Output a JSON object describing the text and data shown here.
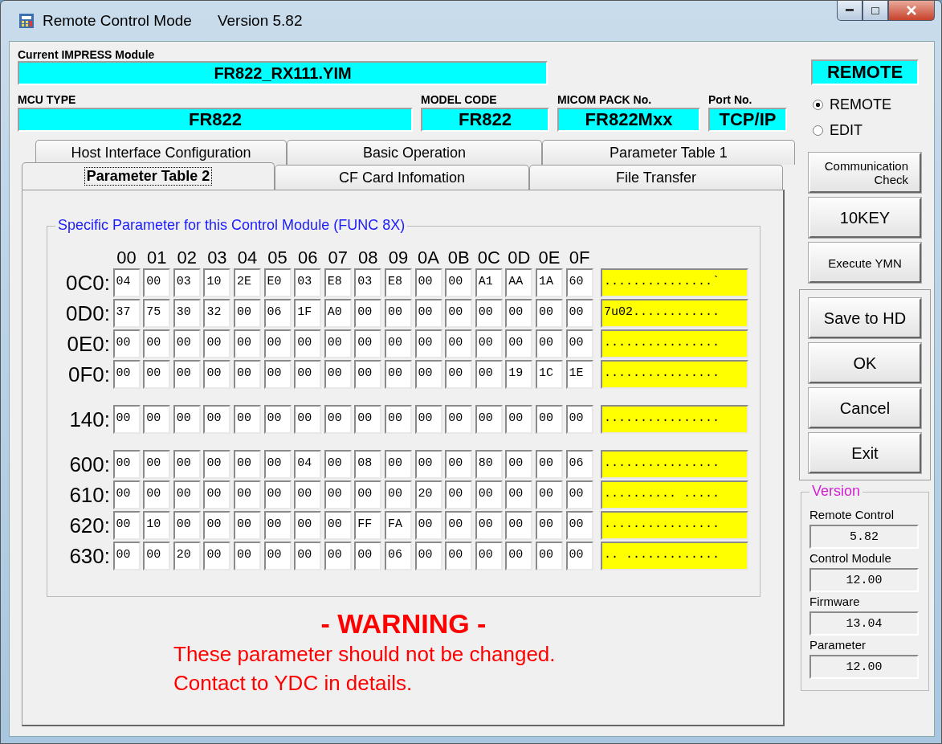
{
  "window": {
    "title": "Remote Control Mode",
    "version": "Version  5.82"
  },
  "module": {
    "label": "Current IMPRESS Module",
    "value": "FR822_RX111.YIM"
  },
  "info_fields": [
    {
      "label": "MCU TYPE",
      "value": "FR822"
    },
    {
      "label": "MODEL CODE",
      "value": "FR822"
    },
    {
      "label": "MICOM PACK No.",
      "value": "FR822Mxx"
    },
    {
      "label": "Port No.",
      "value": "TCP/IP"
    }
  ],
  "tab_rows": [
    [
      {
        "label": "Host Interface Configuration",
        "selected": false
      },
      {
        "label": "Basic Operation",
        "selected": false
      },
      {
        "label": "Parameter Table 1",
        "selected": false
      }
    ],
    [
      {
        "label": "Parameter Table 2",
        "selected": true
      },
      {
        "label": "CF Card Infomation",
        "selected": false
      },
      {
        "label": "File Transfer",
        "selected": false
      }
    ]
  ],
  "parameter_group": {
    "title": "Specific Parameter for this Control Module (FUNC 8X)",
    "columns": [
      "00",
      "01",
      "02",
      "03",
      "04",
      "05",
      "06",
      "07",
      "08",
      "09",
      "0A",
      "0B",
      "0C",
      "0D",
      "0E",
      "0F"
    ],
    "groups": [
      {
        "rows": [
          {
            "address": "0C0:",
            "cells": [
              "04",
              "00",
              "03",
              "10",
              "2E",
              "E0",
              "03",
              "E8",
              "03",
              "E8",
              "00",
              "00",
              "A1",
              "AA",
              "1A",
              "60"
            ],
            "ascii": "...............`"
          },
          {
            "address": "0D0:",
            "cells": [
              "37",
              "75",
              "30",
              "32",
              "00",
              "06",
              "1F",
              "A0",
              "00",
              "00",
              "00",
              "00",
              "00",
              "00",
              "00",
              "00"
            ],
            "ascii": "7u02............"
          },
          {
            "address": "0E0:",
            "cells": [
              "00",
              "00",
              "00",
              "00",
              "00",
              "00",
              "00",
              "00",
              "00",
              "00",
              "00",
              "00",
              "00",
              "00",
              "00",
              "00"
            ],
            "ascii": "................"
          },
          {
            "address": "0F0:",
            "cells": [
              "00",
              "00",
              "00",
              "00",
              "00",
              "00",
              "00",
              "00",
              "00",
              "00",
              "00",
              "00",
              "00",
              "19",
              "1C",
              "1E"
            ],
            "ascii": "................"
          }
        ]
      },
      {
        "rows": [
          {
            "address": "140:",
            "cells": [
              "00",
              "00",
              "00",
              "00",
              "00",
              "00",
              "00",
              "00",
              "00",
              "00",
              "00",
              "00",
              "00",
              "00",
              "00",
              "00"
            ],
            "ascii": "................"
          }
        ]
      },
      {
        "rows": [
          {
            "address": "600:",
            "cells": [
              "00",
              "00",
              "00",
              "00",
              "00",
              "00",
              "04",
              "00",
              "08",
              "00",
              "00",
              "00",
              "80",
              "00",
              "00",
              "06"
            ],
            "ascii": "................"
          },
          {
            "address": "610:",
            "cells": [
              "00",
              "00",
              "00",
              "00",
              "00",
              "00",
              "00",
              "00",
              "00",
              "00",
              "20",
              "00",
              "00",
              "00",
              "00",
              "00"
            ],
            "ascii": ".......... ....."
          },
          {
            "address": "620:",
            "cells": [
              "00",
              "10",
              "00",
              "00",
              "00",
              "00",
              "00",
              "00",
              "FF",
              "FA",
              "00",
              "00",
              "00",
              "00",
              "00",
              "00"
            ],
            "ascii": "................"
          },
          {
            "address": "630:",
            "cells": [
              "00",
              "00",
              "20",
              "00",
              "00",
              "00",
              "00",
              "00",
              "00",
              "06",
              "00",
              "00",
              "00",
              "00",
              "00",
              "00"
            ],
            "ascii": ".. ............."
          }
        ]
      }
    ]
  },
  "warning": {
    "title": "- WARNING -",
    "lines": [
      "These parameter should not be changed.",
      "Contact to YDC in details."
    ]
  },
  "status": "REMOTE",
  "mode_options": [
    {
      "label": "REMOTE",
      "selected": true
    },
    {
      "label": "EDIT",
      "selected": false
    }
  ],
  "side_buttons": [
    "Communication\nCheck",
    "10KEY",
    "Execute YMN"
  ],
  "action_buttons": [
    "Save to HD",
    "OK",
    "Cancel",
    "Exit"
  ],
  "version_group": {
    "title": "Version",
    "items": [
      {
        "label": "Remote Control",
        "value": "5.82"
      },
      {
        "label": "Control Module",
        "value": "12.00"
      },
      {
        "label": "Firmware",
        "value": "13.04"
      },
      {
        "label": "Parameter",
        "value": "12.00"
      }
    ]
  }
}
